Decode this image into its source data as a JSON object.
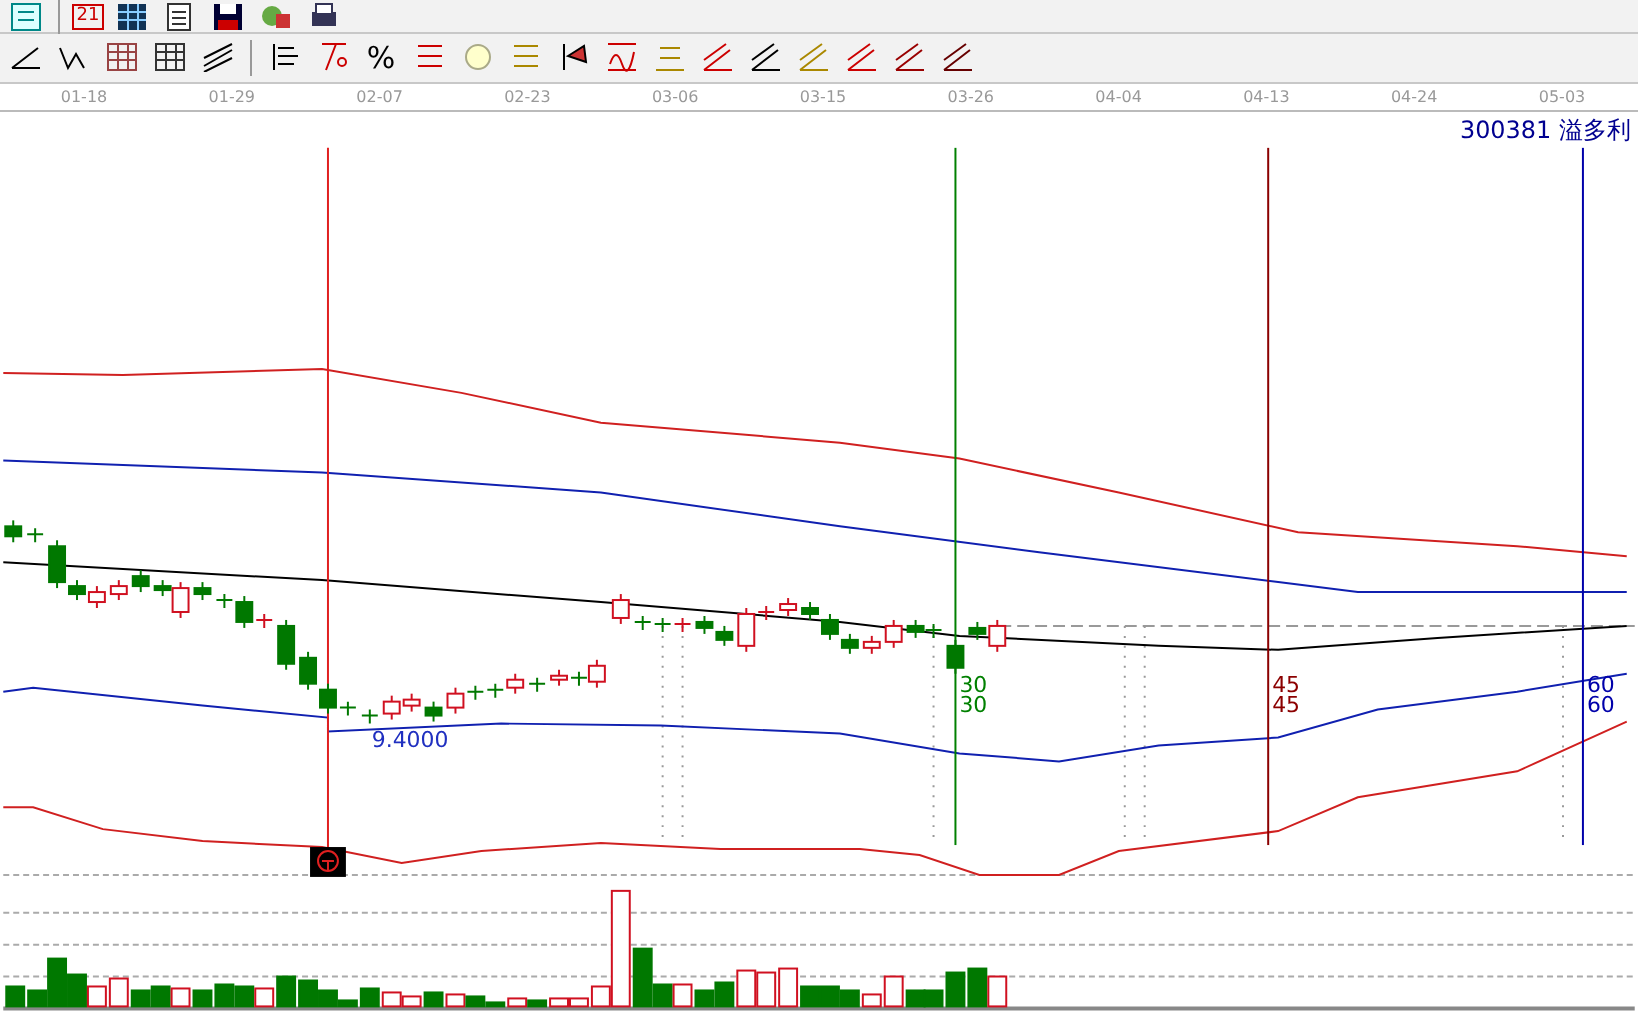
{
  "toolbar_top": {
    "calendar_day": "21"
  },
  "toolbar_bottom": {
    "percent": "%"
  },
  "date_axis": {
    "ticks": [
      "01-18",
      "01-29",
      "02-07",
      "02-23",
      "03-06",
      "03-15",
      "03-26",
      "04-04",
      "04-13",
      "04-24",
      "05-03"
    ]
  },
  "chart": {
    "stock_label": "300381 溢多利",
    "low_price": "9.4000",
    "cycle_markers": [
      {
        "labels": [
          "30",
          "30"
        ],
        "color": "#008000"
      },
      {
        "labels": [
          "45",
          "45"
        ],
        "color": "#8b0000"
      },
      {
        "labels": [
          "60",
          "60"
        ],
        "color": "#0000aa"
      }
    ]
  }
}
